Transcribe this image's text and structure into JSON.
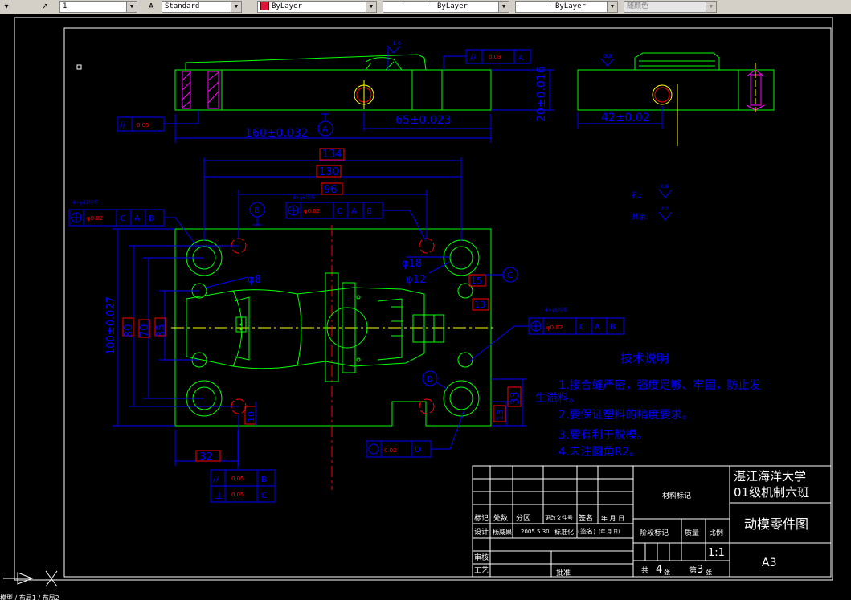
{
  "toolbar": {
    "dimstyle_value": "1",
    "textstyle_value": "Standard",
    "color_value": "ByLayer",
    "linetype_value": "ByLayer",
    "lineweight_value": "ByLayer",
    "plotstyle_value": "随颜色"
  },
  "drawing": {
    "top_roughness": "1.6",
    "parallel_top_tol": "0.03",
    "parallel_top_ref": "A",
    "side_roughness": "0.8",
    "parallel_left_tol": "0.05",
    "datum_a": "A",
    "datum_b": "B",
    "datum_c": "C",
    "datum_d": "D",
    "dim_160": "160±0.032",
    "dim_65": "65±0.023",
    "dim_20": "20±0.016",
    "dim_42": "42±0.02",
    "dim_134": "134",
    "dim_130": "130",
    "dim_96": "96",
    "dim_100": "100±0.027",
    "dim_80": "80",
    "dim_70": "70",
    "dim_35": "35",
    "dim_32": "32",
    "dim_33": "33",
    "dim_13": "13",
    "dim_15": "15",
    "dim_10": "10",
    "dim_phi18": "φ18",
    "dim_phi12": "φ12",
    "dim_phi8": "φ8",
    "pos_note_4x12": "4×φ12均布",
    "pos_note_4x8": "4×φ8均布",
    "pos_note_4x6": "4×φ6均布",
    "pos_tol": "φ0.02",
    "circ_tol": "0.02",
    "bottom_para_tol": "0.05",
    "bottom_perp_tol": "0.05",
    "hole_label": "孔:",
    "hole_rough": "0.8",
    "rest_label": "其余:",
    "rest_rough": "3.2"
  },
  "notes": {
    "title": "技术说明",
    "line1a": "1.接合缝严密，强度足够、牢固，防止发",
    "line1b": "生溢料。",
    "line2": "2.要保证塑料的精度要求。",
    "line3": "3.要有利于脱模。",
    "line4": "4.未注圆角R2。"
  },
  "titleblock": {
    "material": "材料标记",
    "school1": "湛江海洋大学",
    "school2": "01级机制六班",
    "part_name": "动模零件图",
    "col_mark": "标记",
    "col_count": "处数",
    "col_zone": "分区",
    "col_doc": "更改文件号",
    "col_sign": "签名",
    "col_date": "年 月 日",
    "design": "设计",
    "designer": "杨威果",
    "design_date": "2005.5.30",
    "standard": "标准化",
    "sign_paren": "(签名)",
    "date_paren": "(年 月 日)",
    "stage": "阶段标记",
    "mass": "质量",
    "ratio": "比例",
    "scale": "1:1",
    "review": "审核",
    "process": "工艺",
    "approve": "批准",
    "total": "共",
    "total_n": "4",
    "zhang1": "张",
    "di": "第",
    "sheet_n": "3",
    "zhang2": "张",
    "paper": "A3"
  },
  "status": {
    "tabs": "模型 / 布局1 / 布局2"
  }
}
